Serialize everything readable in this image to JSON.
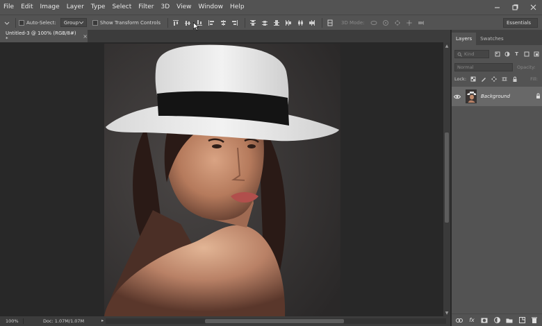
{
  "menubar": {
    "items": [
      "File",
      "Edit",
      "Image",
      "Layer",
      "Type",
      "Select",
      "Filter",
      "3D",
      "View",
      "Window",
      "Help"
    ]
  },
  "options_bar": {
    "auto_select_label": "Auto-Select:",
    "auto_select_value": "Group",
    "show_transform_label": "Show Transform Controls",
    "mode_3d_label": "3D Mode:",
    "workspace": "Essentials"
  },
  "document": {
    "tab_title": "Untitled-3 @ 100% (RGB/8#) *",
    "close_glyph": "×"
  },
  "status": {
    "zoom": "100%",
    "doc_info": "Doc: 1.07M/1.07M",
    "arrow": "▸"
  },
  "layers_panel": {
    "tabs": [
      "Layers",
      "Swatches"
    ],
    "kind_placeholder": "Kind",
    "blend_mode": "Normal",
    "opacity_label": "Opacity:",
    "lock_label": "Lock:",
    "fill_label": "Fill:",
    "layers": [
      {
        "name": "Background",
        "visible": true,
        "locked": true
      }
    ]
  },
  "colors": {
    "chrome": "#535353",
    "canvas_bg": "#282828",
    "panel_dark": "#424242",
    "selected_layer": "#686868"
  },
  "icons": {
    "move_tool": "move-icon",
    "visibility": "eye-icon",
    "lock": "lock-icon"
  }
}
